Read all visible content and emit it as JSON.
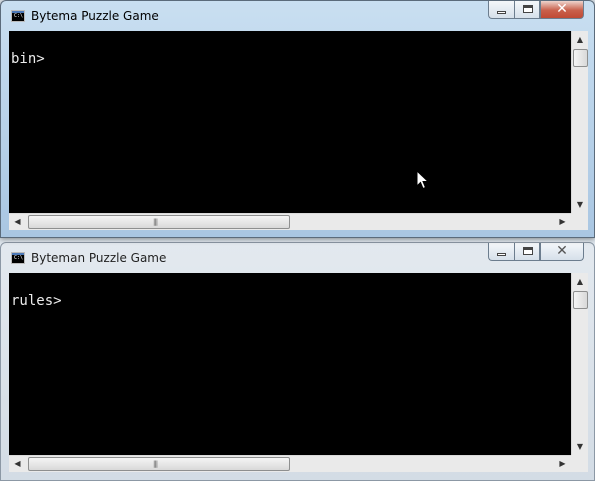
{
  "windows": [
    {
      "title": "Bytema Puzzle Game",
      "icon": "console-icon",
      "icon_text": "C:\\",
      "state": "active",
      "prompt": "bin>"
    },
    {
      "title": "Byteman Puzzle Game",
      "icon": "console-icon",
      "icon_text": "C:\\",
      "state": "inactive",
      "prompt": "rules>"
    }
  ],
  "caption_buttons": {
    "minimize_icon": "minimize-icon",
    "maximize_icon": "maximize-icon",
    "close_glyph": "✕"
  },
  "scrollbar_glyphs": {
    "up": "▲",
    "down": "▼",
    "left": "◀",
    "right": "▶",
    "grip": "|||"
  },
  "colors": {
    "console_bg": "#000000",
    "console_text": "#ececec",
    "close_button": "#c9604b"
  }
}
